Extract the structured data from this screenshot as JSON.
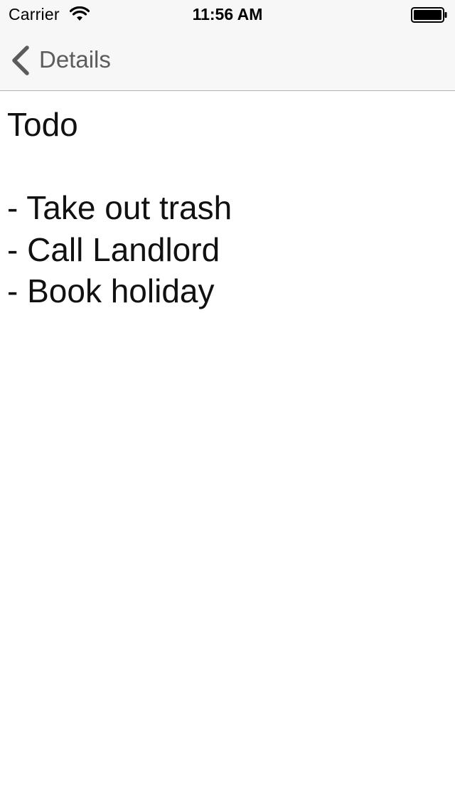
{
  "status_bar": {
    "carrier": "Carrier",
    "time": "11:56 AM",
    "wifi_icon": "wifi-icon",
    "battery_icon": "battery-full-icon"
  },
  "nav_bar": {
    "back_icon": "chevron-left-icon",
    "back_label": "Details",
    "tint_color": "#5c5c5c"
  },
  "note": {
    "lines": [
      "Todo",
      "",
      "- Take out trash",
      "- Call Landlord",
      "- Book holiday"
    ]
  }
}
